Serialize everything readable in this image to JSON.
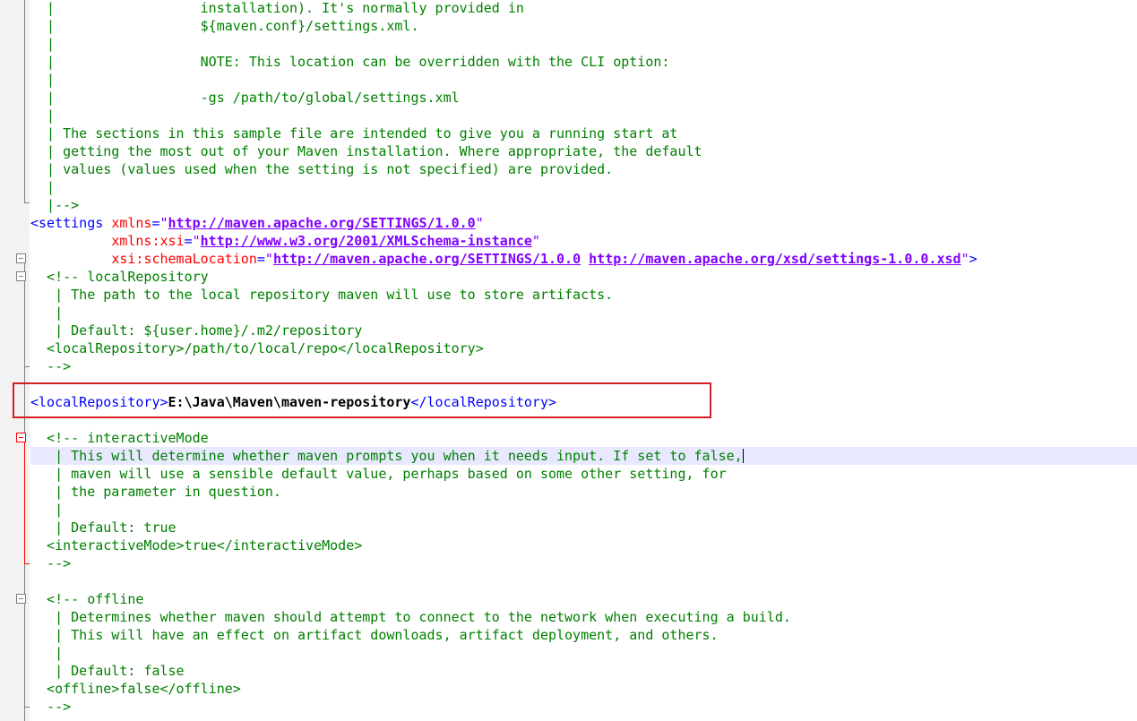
{
  "editor": {
    "lines": [
      {
        "segments": [
          {
            "cls": "c",
            "text": "  |                  installation). It's normally provided in"
          }
        ]
      },
      {
        "segments": [
          {
            "cls": "c",
            "text": "  |                  ${maven.conf}/settings.xml."
          }
        ]
      },
      {
        "segments": [
          {
            "cls": "c",
            "text": "  |"
          }
        ]
      },
      {
        "segments": [
          {
            "cls": "c",
            "text": "  |                  NOTE: This location can be overridden with the CLI option:"
          }
        ]
      },
      {
        "segments": [
          {
            "cls": "c",
            "text": "  |"
          }
        ]
      },
      {
        "segments": [
          {
            "cls": "c",
            "text": "  |                  -gs /path/to/global/settings.xml"
          }
        ]
      },
      {
        "segments": [
          {
            "cls": "c",
            "text": "  |"
          }
        ]
      },
      {
        "segments": [
          {
            "cls": "c",
            "text": "  | The sections in this sample file are intended to give you a running start at"
          }
        ]
      },
      {
        "segments": [
          {
            "cls": "c",
            "text": "  | getting the most out of your Maven installation. Where appropriate, the default"
          }
        ]
      },
      {
        "segments": [
          {
            "cls": "c",
            "text": "  | values (values used when the setting is not specified) are provided."
          }
        ]
      },
      {
        "segments": [
          {
            "cls": "c",
            "text": "  |"
          }
        ]
      },
      {
        "segments": [
          {
            "cls": "c",
            "text": "  |-->"
          }
        ]
      },
      {
        "segments": [
          {
            "cls": "tg",
            "text": "<settings "
          },
          {
            "cls": "at",
            "text": "xmlns"
          },
          {
            "cls": "tg",
            "text": "="
          },
          {
            "cls": "q",
            "text": "\""
          },
          {
            "cls": "av",
            "text": "http://maven.apache.org/SETTINGS/1.0.0"
          },
          {
            "cls": "q",
            "text": "\""
          }
        ]
      },
      {
        "segments": [
          {
            "cls": "",
            "text": "          "
          },
          {
            "cls": "at",
            "text": "xmlns:xsi"
          },
          {
            "cls": "tg",
            "text": "="
          },
          {
            "cls": "q",
            "text": "\""
          },
          {
            "cls": "av",
            "text": "http://www.w3.org/2001/XMLSchema-instance"
          },
          {
            "cls": "q",
            "text": "\""
          }
        ]
      },
      {
        "segments": [
          {
            "cls": "",
            "text": "          "
          },
          {
            "cls": "at",
            "text": "xsi:schemaLocation"
          },
          {
            "cls": "tg",
            "text": "="
          },
          {
            "cls": "q",
            "text": "\""
          },
          {
            "cls": "av",
            "text": "http://maven.apache.org/SETTINGS/1.0.0"
          },
          {
            "cls": "",
            "text": " "
          },
          {
            "cls": "av",
            "text": "http://maven.apache.org/xsd/settings-1.0.0.xsd"
          },
          {
            "cls": "q",
            "text": "\""
          },
          {
            "cls": "tg",
            "text": ">"
          }
        ]
      },
      {
        "segments": [
          {
            "cls": "c",
            "text": "  <!-- localRepository"
          }
        ]
      },
      {
        "segments": [
          {
            "cls": "c",
            "text": "   | The path to the local repository maven will use to store artifacts."
          }
        ]
      },
      {
        "segments": [
          {
            "cls": "c",
            "text": "   |"
          }
        ]
      },
      {
        "segments": [
          {
            "cls": "c",
            "text": "   | Default: ${user.home}/.m2/repository"
          }
        ]
      },
      {
        "segments": [
          {
            "cls": "c",
            "text": "  <localRepository>/path/to/local/repo</localRepository>"
          }
        ]
      },
      {
        "segments": [
          {
            "cls": "c",
            "text": "  -->"
          }
        ]
      },
      {
        "segments": [
          {
            "cls": "",
            "text": ""
          }
        ]
      },
      {
        "segments": [
          {
            "cls": "tg",
            "text": "<localRepository>"
          },
          {
            "cls": "tx",
            "text": "E:\\Java\\Maven\\maven-repository"
          },
          {
            "cls": "tg",
            "text": "</localRepository>"
          }
        ]
      },
      {
        "segments": [
          {
            "cls": "",
            "text": ""
          }
        ]
      },
      {
        "segments": [
          {
            "cls": "c",
            "text": "  <!-- interactiveMode"
          }
        ]
      },
      {
        "segments": [
          {
            "cls": "c",
            "text": "   | This will determine whether maven prompts you when it needs input. If set to false,"
          }
        ],
        "current": true
      },
      {
        "segments": [
          {
            "cls": "c",
            "text": "   | maven will use a sensible default value, perhaps based on some other setting, for"
          }
        ]
      },
      {
        "segments": [
          {
            "cls": "c",
            "text": "   | the parameter in question."
          }
        ]
      },
      {
        "segments": [
          {
            "cls": "c",
            "text": "   |"
          }
        ]
      },
      {
        "segments": [
          {
            "cls": "c",
            "text": "   | Default: true"
          }
        ]
      },
      {
        "segments": [
          {
            "cls": "c",
            "text": "  <interactiveMode>true</interactiveMode>"
          }
        ]
      },
      {
        "segments": [
          {
            "cls": "c",
            "text": "  -->"
          }
        ]
      },
      {
        "segments": [
          {
            "cls": "",
            "text": ""
          }
        ]
      },
      {
        "segments": [
          {
            "cls": "c",
            "text": "  <!-- offline"
          }
        ]
      },
      {
        "segments": [
          {
            "cls": "c",
            "text": "   | Determines whether maven should attempt to connect to the network when executing a build."
          }
        ]
      },
      {
        "segments": [
          {
            "cls": "c",
            "text": "   | This will have an effect on artifact downloads, artifact deployment, and others."
          }
        ]
      },
      {
        "segments": [
          {
            "cls": "c",
            "text": "   |"
          }
        ]
      },
      {
        "segments": [
          {
            "cls": "c",
            "text": "   | Default: false"
          }
        ]
      },
      {
        "segments": [
          {
            "cls": "c",
            "text": "  <offline>false</offline>"
          }
        ]
      },
      {
        "segments": [
          {
            "cls": "c",
            "text": "  -->"
          }
        ]
      }
    ]
  }
}
